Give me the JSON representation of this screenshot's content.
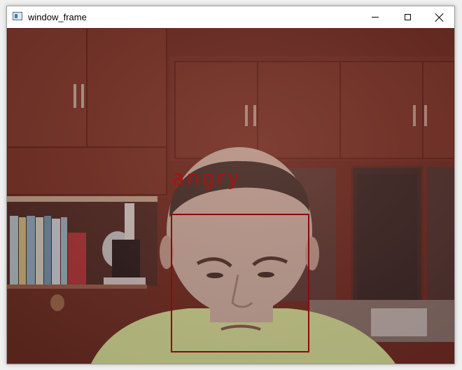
{
  "window": {
    "title": "window_frame",
    "controls": [
      "minimize",
      "maximize",
      "close"
    ]
  },
  "icons": {
    "app": "app-window-icon",
    "minimize": "minimize-icon",
    "maximize": "maximize-icon",
    "close": "close-icon"
  },
  "frame": {
    "detection": {
      "label": "angry"
    }
  },
  "colors": {
    "detection_box": "#8b0a0a",
    "detection_label": "#a3160f"
  }
}
